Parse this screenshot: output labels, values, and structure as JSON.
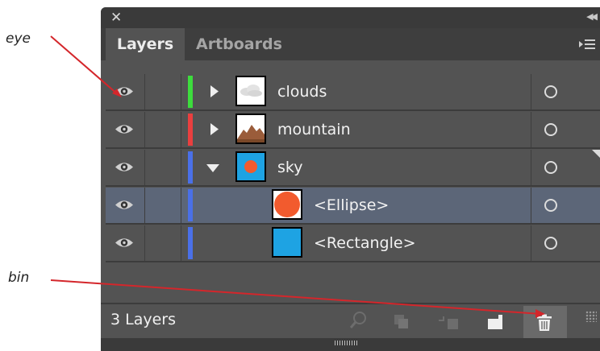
{
  "annotations": {
    "eye": "eye",
    "bin": "bin"
  },
  "panel": {
    "tabs": [
      {
        "label": "Layers"
      },
      {
        "label": "Artboards"
      }
    ],
    "layers": [
      {
        "name": "clouds",
        "color": "#3ddc3d",
        "expanded": false,
        "indent": 0,
        "thumbnail": "cloud-thumbnail",
        "selected": false
      },
      {
        "name": "mountain",
        "color": "#ea3f3f",
        "expanded": false,
        "indent": 0,
        "thumbnail": "mountain-thumbnail",
        "selected": false
      },
      {
        "name": "sky",
        "color": "#4a70e8",
        "expanded": true,
        "indent": 0,
        "thumbnail": "sky-thumbnail",
        "selected": false
      },
      {
        "name": "<Ellipse>",
        "color": "#4a70e8",
        "indent": 1,
        "thumbnail": "ellipse-thumbnail",
        "selected": true
      },
      {
        "name": "<Rectangle>",
        "color": "#4a70e8",
        "indent": 1,
        "thumbnail": "rectangle-thumbnail",
        "selected": false
      }
    ],
    "footer": {
      "count": "3 Layers"
    },
    "colors": {
      "annotation_line": "#d4262b",
      "ellipse": "#f25b2e",
      "sky_blue": "#1ea3e3"
    }
  }
}
